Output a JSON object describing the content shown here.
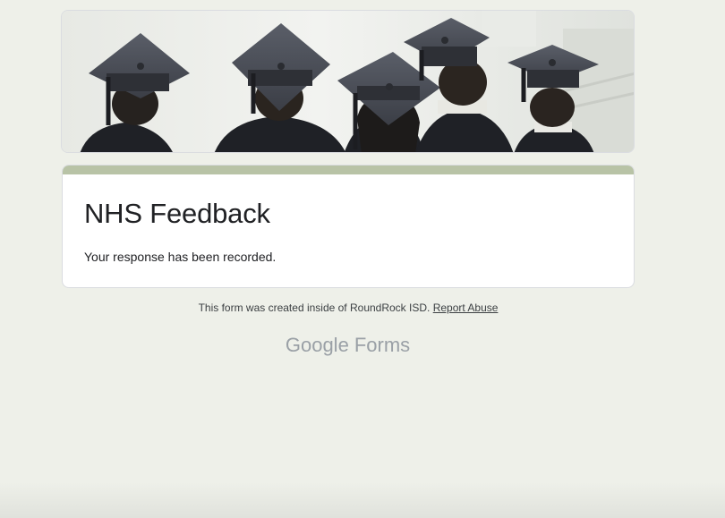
{
  "form": {
    "title": "NHS Feedback",
    "confirmation_message": "Your response has been recorded."
  },
  "footer": {
    "note": "This form was created inside of RoundRock ISD.",
    "report_link": "Report Abuse"
  },
  "branding": {
    "logo_word": "Google",
    "product_word": "Forms"
  },
  "colors": {
    "background": "#eef0e9",
    "accent": "#b8c3a6",
    "card": "#ffffff",
    "text": "#202124",
    "brand_grey": "#9aa0a6"
  },
  "header_image": {
    "subject": "graduation-caps-image"
  }
}
